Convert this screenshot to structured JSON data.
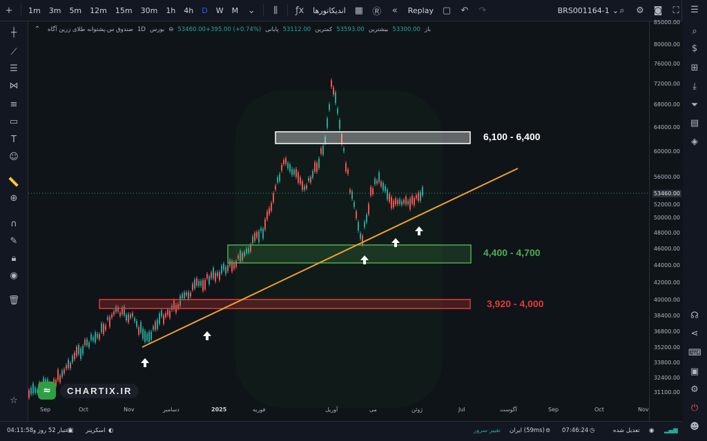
{
  "topbar": {
    "add_symbol": "+",
    "intervals": [
      "1m",
      "3m",
      "5m",
      "12m",
      "15m",
      "30m",
      "1h",
      "4h",
      "D",
      "W",
      "M"
    ],
    "active_interval": "D",
    "indicators_label": "اندیکاتورها",
    "replay_label": "Replay",
    "symbol": "BRS001164-1"
  },
  "legend": {
    "title": "صندوق س.پشتوانه طلای زرین آگاه",
    "interval": "1D",
    "exchange": "بورس",
    "open_label": "باز",
    "open_value": "53300.00",
    "high_label": "بیشترین",
    "high_value": "53593.00",
    "low_label": "کمترین",
    "low_value": "53112.00",
    "close_label": "پایانی",
    "close_value": "53460.00+395.00 (+0.74%)"
  },
  "zones": {
    "top": {
      "label": "6,100 - 6,400",
      "color": "#ffffff"
    },
    "middle": {
      "label": "4,400 - 4,700",
      "color": "#4caf50"
    },
    "bottom": {
      "label": "3,920 - 4,000",
      "color": "#e53935"
    }
  },
  "logo": {
    "text": "CHARTIX.IR"
  },
  "price_scale": {
    "labels": [
      "85000.00",
      "80000.00",
      "76000.00",
      "72000.00",
      "68000.00",
      "64000.00",
      "60000.00",
      "56000.00",
      "52000.00",
      "50000.00",
      "48000.00",
      "46000.00",
      "44000.00",
      "42000.00",
      "40000.00",
      "38400.00",
      "36800.00",
      "35200.00",
      "33800.00",
      "32400.00",
      "31100.00"
    ],
    "current": "53460.00"
  },
  "time_scale": {
    "labels": [
      "Sep",
      "Oct",
      "Nov",
      "دسامبر",
      "2025",
      "فوریه",
      "آوریل",
      "می",
      "ژوئن",
      "Jul",
      "آگوست",
      "Sep",
      "Oct",
      "Nov"
    ]
  },
  "status": {
    "time": "04:11:58",
    "credit": "اعتبار 52 روز و",
    "screener": "اسکرینر",
    "server_change": "تغییر سرور",
    "server": "ایران (59ms)",
    "clock": "07:46:24",
    "adjusted": "تعدیل شده"
  },
  "colors": {
    "up": "#26a69a",
    "down": "#ef5350",
    "trend": "#f0a030"
  },
  "chart_data": {
    "type": "candlestick",
    "note_levels": [
      "6,100 - 6,400",
      "4,400 - 4,700",
      "3,920 - 4,000"
    ],
    "ylim": [
      31100,
      85000
    ],
    "last": 53460
  }
}
